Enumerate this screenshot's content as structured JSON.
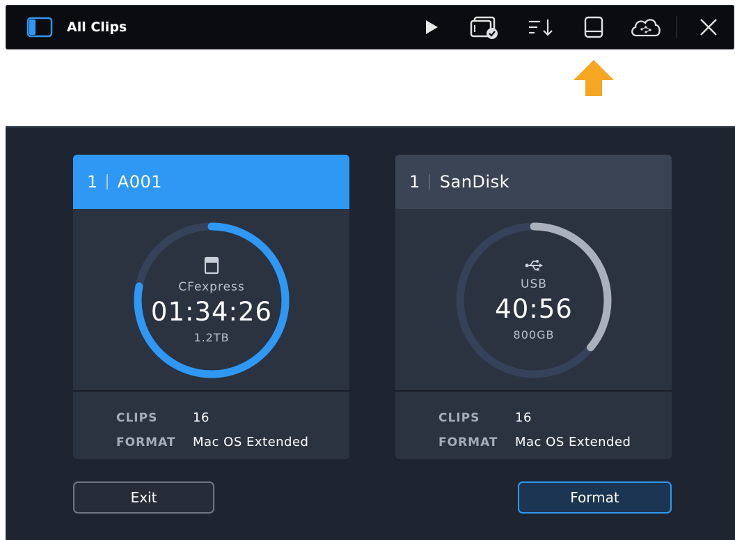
{
  "topbar": {
    "title": "All Clips",
    "icons": [
      "sidebar-toggle-icon",
      "play-icon",
      "clips-select-icon",
      "sort-icon",
      "storage-media-icon",
      "cloud-icon",
      "close-icon"
    ]
  },
  "pointer": {
    "color": "#f5a623",
    "target": "storage-media-icon"
  },
  "colors": {
    "accent": "#2f98f4",
    "ring_secondary": "#aab1bd"
  },
  "cards": [
    {
      "slot": "1",
      "name": "A001",
      "media_type": "CFexpress",
      "media_icon": "cfexpress-card-icon",
      "timecode": "01:34:26",
      "capacity": "1.2TB",
      "remaining_fraction": 0.78,
      "selected": true,
      "stats": {
        "clips_label": "CLIPS",
        "clips": "16",
        "format_label": "FORMAT",
        "format": "Mac OS Extended"
      }
    },
    {
      "slot": "1",
      "name": "SanDisk",
      "media_type": "USB",
      "media_icon": "usb-icon",
      "timecode": "40:56",
      "capacity": "800GB",
      "remaining_fraction": 0.36,
      "selected": false,
      "stats": {
        "clips_label": "CLIPS",
        "clips": "16",
        "format_label": "FORMAT",
        "format": "Mac OS Extended"
      }
    }
  ],
  "buttons": {
    "exit": "Exit",
    "format": "Format"
  }
}
